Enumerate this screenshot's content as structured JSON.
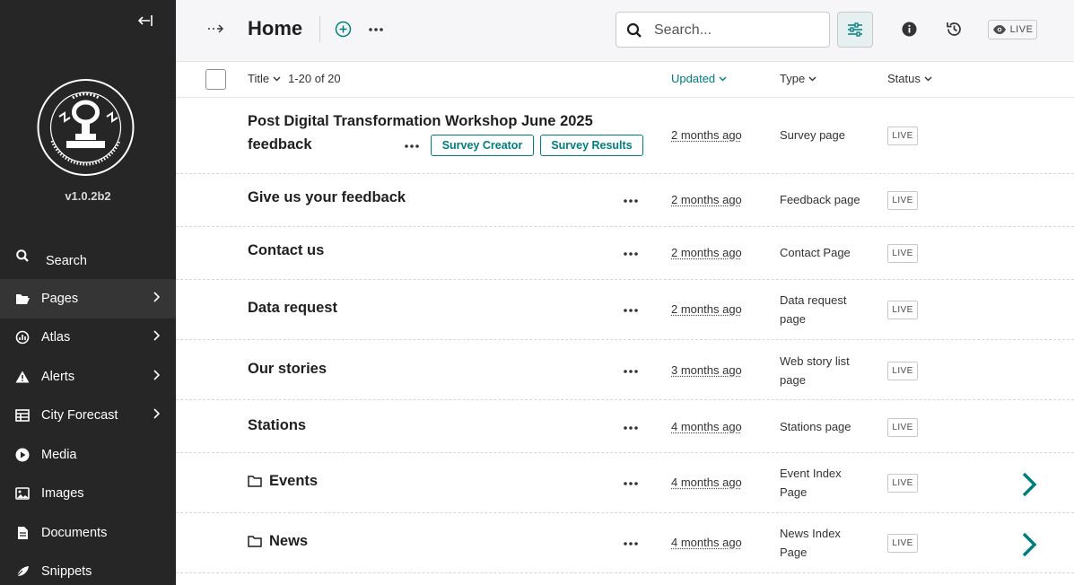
{
  "sidebar": {
    "version": "v1.0.2b2",
    "items": [
      {
        "label": "Search",
        "icon": "search-icon"
      },
      {
        "label": "Pages",
        "icon": "folder-open-icon",
        "has_submenu": true,
        "active": true
      },
      {
        "label": "Atlas",
        "icon": "chart-icon",
        "has_submenu": true
      },
      {
        "label": "Alerts",
        "icon": "warning-icon",
        "has_submenu": true
      },
      {
        "label": "City Forecast",
        "icon": "table-icon",
        "has_submenu": true
      },
      {
        "label": "Media",
        "icon": "play-icon"
      },
      {
        "label": "Images",
        "icon": "image-icon"
      },
      {
        "label": "Documents",
        "icon": "document-icon"
      },
      {
        "label": "Snippets",
        "icon": "snippet-icon"
      }
    ]
  },
  "header": {
    "title": "Home",
    "search_placeholder": "Search...",
    "live_label": "LIVE"
  },
  "columns": {
    "title": "Title",
    "count": "1-20 of 20",
    "updated": "Updated",
    "type": "Type",
    "status": "Status"
  },
  "rows": [
    {
      "title_line1": "Post Digital Transformation Workshop June 2025",
      "title_line2": "feedback",
      "updated": "2 months ago",
      "type": "Survey page",
      "status": "LIVE",
      "buttons": [
        "Survey Creator",
        "Survey Results"
      ]
    },
    {
      "title": "Give us your feedback",
      "updated": "2 months ago",
      "type": "Feedback page",
      "status": "LIVE"
    },
    {
      "title": "Contact us",
      "updated": "2 months ago",
      "type": "Contact Page",
      "status": "LIVE"
    },
    {
      "title": "Data request",
      "updated": "2 months ago",
      "type_line1": "Data request",
      "type_line2": "page",
      "status": "LIVE"
    },
    {
      "title": "Our stories",
      "updated": "3 months ago",
      "type_line1": "Web story list",
      "type_line2": "page",
      "status": "LIVE"
    },
    {
      "title": "Stations",
      "updated": "4 months ago",
      "type": "Stations page",
      "status": "LIVE"
    },
    {
      "title": "Events",
      "updated": "4 months ago",
      "type_line1": "Event Index",
      "type_line2": "Page",
      "status": "LIVE",
      "folder": true
    },
    {
      "title": "News",
      "updated": "4 months ago",
      "type_line1": "News Index",
      "type_line2": "Page",
      "status": "LIVE",
      "folder": true
    }
  ],
  "colors": {
    "sidebar_bg": "#262626",
    "accent_teal": "#007d7e",
    "header_bg": "#f6f6f8"
  }
}
